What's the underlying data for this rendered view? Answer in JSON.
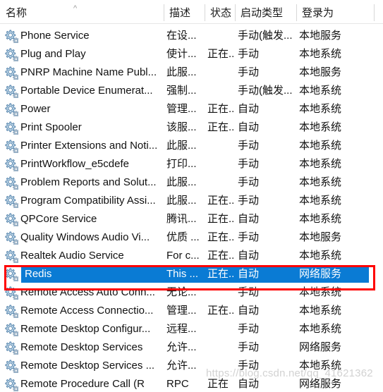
{
  "header": {
    "columns": [
      {
        "label": "名称",
        "sort_indicator": "caret-up-icon"
      },
      {
        "label": "描述",
        "sort_indicator": ""
      },
      {
        "label": "状态",
        "sort_indicator": ""
      },
      {
        "label": "启动类型",
        "sort_indicator": ""
      },
      {
        "label": "登录为",
        "sort_indicator": ""
      }
    ]
  },
  "selection": {
    "selected_service": "Redis",
    "highlight_color": "#0a7bd4",
    "annotation_color": "#ff0000"
  },
  "icons": {
    "service_icon": "gear-icon",
    "sort_caret": "caret-up-icon"
  },
  "watermark": {
    "text": "https://blog.csdn.net/qq_41621362"
  },
  "rows": [
    {
      "name": "Phone Service",
      "desc": "在设...",
      "state": "",
      "startup": "手动(触发...",
      "logon": "本地服务",
      "selected": false
    },
    {
      "name": "Plug and Play",
      "desc": "使计...",
      "state": "正在...",
      "startup": "手动",
      "logon": "本地系统",
      "selected": false
    },
    {
      "name": "PNRP Machine Name Publ...",
      "desc": "此服...",
      "state": "",
      "startup": "手动",
      "logon": "本地服务",
      "selected": false
    },
    {
      "name": "Portable Device Enumerat...",
      "desc": "强制...",
      "state": "",
      "startup": "手动(触发...",
      "logon": "本地系统",
      "selected": false
    },
    {
      "name": "Power",
      "desc": "管理...",
      "state": "正在...",
      "startup": "自动",
      "logon": "本地系统",
      "selected": false
    },
    {
      "name": "Print Spooler",
      "desc": "该服...",
      "state": "正在...",
      "startup": "自动",
      "logon": "本地系统",
      "selected": false
    },
    {
      "name": "Printer Extensions and Noti...",
      "desc": "此服...",
      "state": "",
      "startup": "手动",
      "logon": "本地系统",
      "selected": false
    },
    {
      "name": "PrintWorkflow_e5cdefe",
      "desc": "打印...",
      "state": "",
      "startup": "手动",
      "logon": "本地系统",
      "selected": false
    },
    {
      "name": "Problem Reports and Solut...",
      "desc": "此服...",
      "state": "",
      "startup": "手动",
      "logon": "本地系统",
      "selected": false
    },
    {
      "name": "Program Compatibility Assi...",
      "desc": "此服...",
      "state": "正在...",
      "startup": "手动",
      "logon": "本地系统",
      "selected": false
    },
    {
      "name": "QPCore Service",
      "desc": "腾讯...",
      "state": "正在...",
      "startup": "自动",
      "logon": "本地系统",
      "selected": false
    },
    {
      "name": "Quality Windows Audio Vi...",
      "desc": "优质 ...",
      "state": "正在...",
      "startup": "手动",
      "logon": "本地服务",
      "selected": false
    },
    {
      "name": "Realtek Audio Service",
      "desc": "For c...",
      "state": "正在...",
      "startup": "自动",
      "logon": "本地系统",
      "selected": false
    },
    {
      "name": "Redis",
      "desc": "This ...",
      "state": "正在...",
      "startup": "自动",
      "logon": "网络服务",
      "selected": true
    },
    {
      "name": "Remote Access Auto Conn...",
      "desc": "无论...",
      "state": "",
      "startup": "手动",
      "logon": "本地系统",
      "selected": false
    },
    {
      "name": "Remote Access Connectio...",
      "desc": "管理...",
      "state": "正在...",
      "startup": "自动",
      "logon": "本地系统",
      "selected": false
    },
    {
      "name": "Remote Desktop Configur...",
      "desc": "远程...",
      "state": "",
      "startup": "手动",
      "logon": "本地系统",
      "selected": false
    },
    {
      "name": "Remote Desktop Services",
      "desc": "允许...",
      "state": "",
      "startup": "手动",
      "logon": "网络服务",
      "selected": false
    },
    {
      "name": "Remote Desktop Services ...",
      "desc": "允许...",
      "state": "",
      "startup": "手动",
      "logon": "本地系统",
      "selected": false
    },
    {
      "name": "Remote Procedure Call (R",
      "desc": "RPC",
      "state": "正在",
      "startup": "自动",
      "logon": "网络服务",
      "selected": false
    }
  ]
}
